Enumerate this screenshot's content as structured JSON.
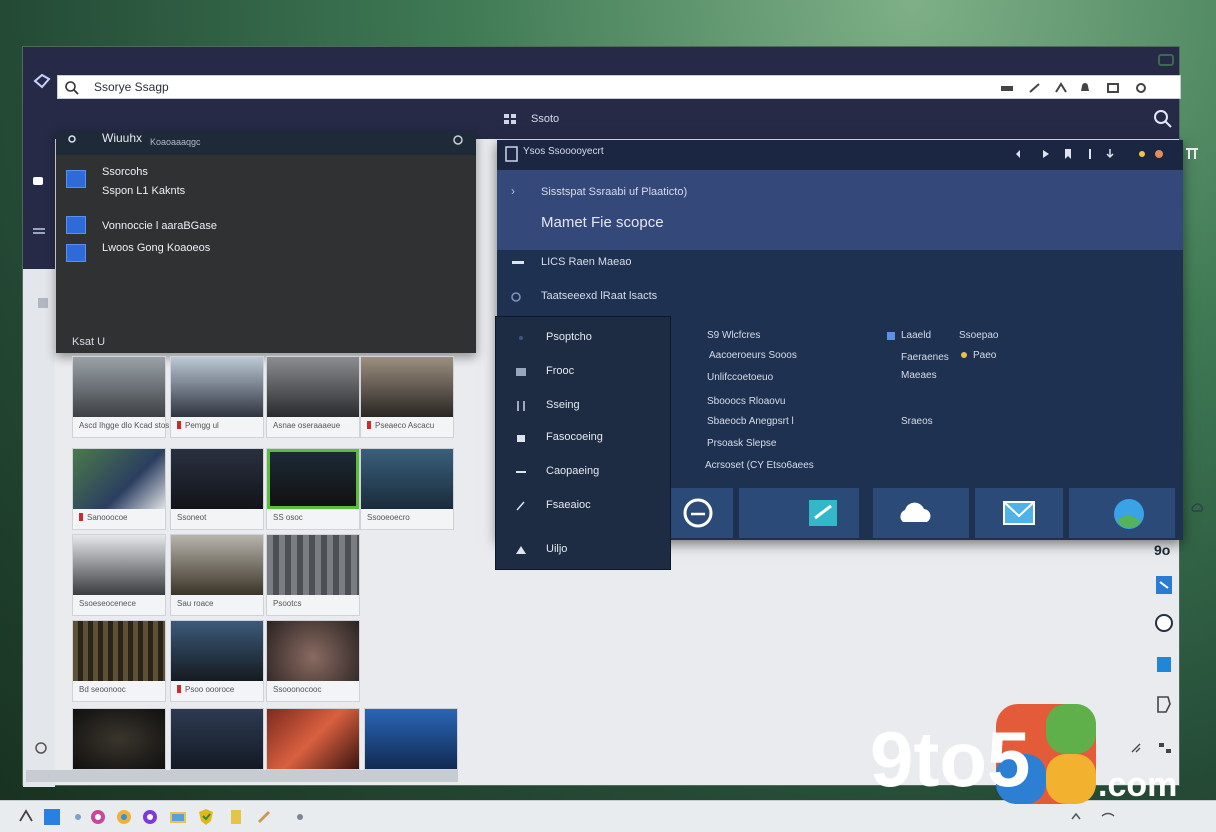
{
  "window": {
    "search_text": "Ssorye Ssagp"
  },
  "subbar": {
    "label": "Ssoto"
  },
  "panel": {
    "title": "Wiuuhx",
    "subtitle": "Koaoaaaqgc",
    "items": [
      {
        "line1": "Ssorcohs",
        "line2": "Sspon L1 Kaknts"
      },
      {
        "line1": "Vonnoccie l aaraBGase",
        "line2": "Lwoos Gong Koaoeos"
      }
    ],
    "footer": "Ksat U"
  },
  "tiles": [
    {
      "caption": "Ascd Ihgge dlo\nKcad stos doo",
      "red": false
    },
    {
      "caption": "Pemgg ul",
      "red": true
    },
    {
      "caption": "Asnae oseraaaeue",
      "red": false
    },
    {
      "caption": "Pseaeco Ascacu",
      "red": true
    },
    {
      "caption": "Sanooocoe",
      "red": true
    },
    {
      "caption": "Ssoneot",
      "red": false
    },
    {
      "caption": "SS osoc",
      "red": false
    },
    {
      "caption": "Ssooeoecro",
      "red": false
    },
    {
      "caption": "Ssoeseocenece",
      "red": false
    },
    {
      "caption": "Sau roace",
      "red": false
    },
    {
      "caption": "Psootcs",
      "red": false
    },
    {
      "caption": "",
      "red": false
    },
    {
      "caption": "Bd seoonooc",
      "red": false
    },
    {
      "caption": "Psoo oooroce",
      "red": true
    },
    {
      "caption": "Ssooonocooc",
      "red": false
    },
    {
      "caption": "",
      "red": false
    }
  ],
  "right_panel": {
    "header": "Ysos Ssooooyecrt",
    "highlight_line1": "Sisstspat Ssraabi uf Plaaticto)",
    "highlight_line2": "Mamet Fie scopce",
    "row1": "LICS Raen Maeao",
    "row2": "Taatseeexd lRaat lsacts",
    "col2": [
      "S9 Wlcfcres",
      "Aacoeroeurs Sooos",
      "Unlifccoetoeuo",
      "Sbooocs Rloaovu",
      "Sbaeocb Anegpsrt l",
      "Prsoask Slepse",
      "Acrsoset (CY Etso6aees"
    ],
    "col3": [
      "Laaeld",
      "Faeraenes",
      "Maeaes",
      "Sraeos"
    ],
    "col4": [
      "Ssoepao",
      "Paeo"
    ]
  },
  "menu": {
    "items": [
      "Psoptcho",
      "Frooc",
      "Sseing",
      "Fasocoeing",
      "Caopaeing",
      "Fsaeaioc",
      "Uiljo"
    ]
  },
  "right_edge": {
    "label": "9o"
  },
  "watermark": {
    "text_left": "9to5",
    "text_right": ".com"
  }
}
